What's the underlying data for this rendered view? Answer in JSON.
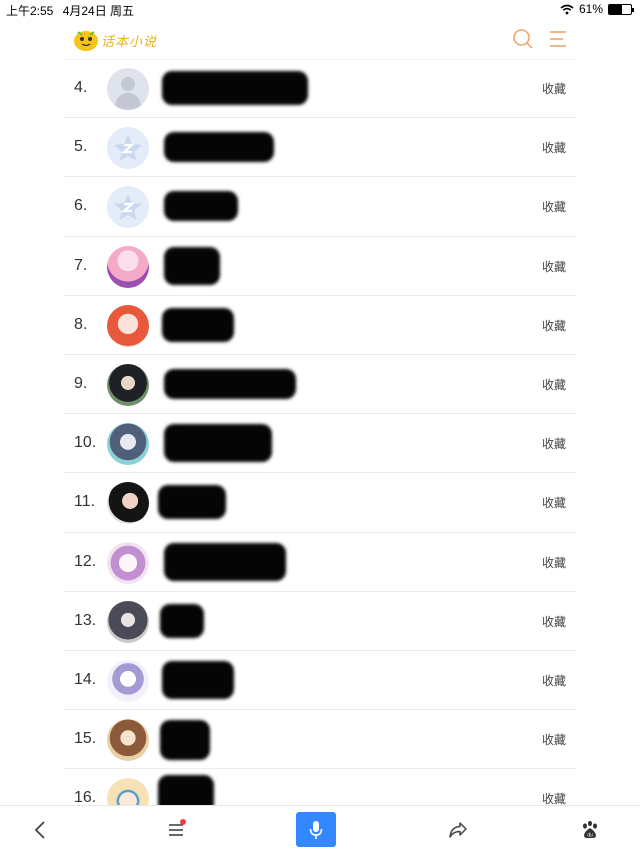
{
  "status_bar": {
    "time": "上午2:55",
    "date": "4月24日 周五",
    "battery": "61%"
  },
  "header": {
    "logo_text": "话本小说"
  },
  "list": {
    "action_label": "收藏",
    "rows": [
      {
        "rank": "4.",
        "avatar": "default-avatar",
        "avatar_colors": [
          "#dfe3ec",
          "#c3c8d4"
        ]
      },
      {
        "rank": "5.",
        "avatar": "qq-avatar",
        "avatar_colors": [
          "#e3ecf8",
          "#c9d8ee"
        ]
      },
      {
        "rank": "6.",
        "avatar": "qq-avatar",
        "avatar_colors": [
          "#e3ecf8",
          "#c9d8ee"
        ]
      },
      {
        "rank": "7.",
        "avatar": "anime-pink-avatar",
        "avatar_colors": [
          "#f4a9c8",
          "#9a4fb1"
        ]
      },
      {
        "rank": "8.",
        "avatar": "anime-orange-avatar",
        "avatar_colors": [
          "#f7d2cc",
          "#e8583a"
        ]
      },
      {
        "rank": "9.",
        "avatar": "photo-avatar",
        "avatar_colors": [
          "#6f8f6c",
          "#1e2226"
        ]
      },
      {
        "rank": "10.",
        "avatar": "anime-teal-avatar",
        "avatar_colors": [
          "#8ad2d8",
          "#51607a"
        ]
      },
      {
        "rank": "11.",
        "avatar": "photo-dark-avatar",
        "avatar_colors": [
          "#e2e0e4",
          "#141414"
        ]
      },
      {
        "rank": "12.",
        "avatar": "anime-lilac-avatar",
        "avatar_colors": [
          "#f1e3f1",
          "#c28fd0"
        ]
      },
      {
        "rank": "13.",
        "avatar": "anime-gray-avatar",
        "avatar_colors": [
          "#c9c9c9",
          "#4b4b58"
        ]
      },
      {
        "rank": "14.",
        "avatar": "anime-chibi-avatar",
        "avatar_colors": [
          "#f3f0fa",
          "#a59ad3"
        ]
      },
      {
        "rank": "15.",
        "avatar": "anime-gold-avatar",
        "avatar_colors": [
          "#e8cfa5",
          "#8a5a3a"
        ]
      },
      {
        "rank": "16.",
        "avatar": "anime-blonde-avatar",
        "avatar_colors": [
          "#f6e2b4",
          "#5aa2c9"
        ]
      }
    ]
  },
  "colors": {
    "accent_orange": "#f0a46b",
    "voice_blue": "#3388ff",
    "logo_yellow": "#f5c518",
    "badge_red": "#f53b3b"
  }
}
